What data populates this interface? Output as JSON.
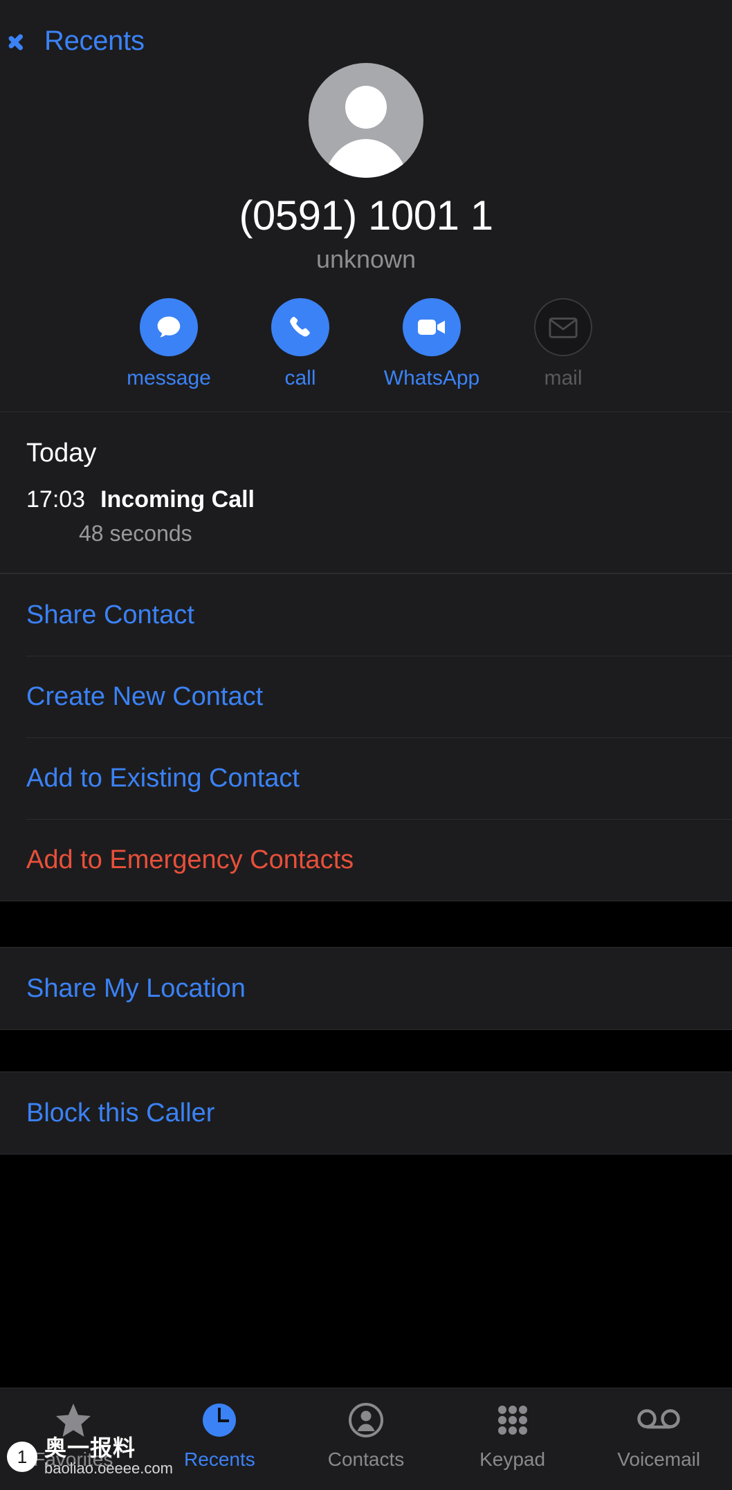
{
  "nav": {
    "back_label": "Recents",
    "back_icon": "chevron-left-icon"
  },
  "contact": {
    "avatar_icon": "person-placeholder-icon",
    "phone_number": "(0591) 1001 1",
    "sub_label": "unknown"
  },
  "actions": [
    {
      "label": "message",
      "icon": "message-bubble-icon",
      "disabled": false
    },
    {
      "label": "call",
      "icon": "phone-icon",
      "disabled": false
    },
    {
      "label": "WhatsApp",
      "icon": "video-camera-icon",
      "disabled": false
    },
    {
      "label": "mail",
      "icon": "envelope-icon",
      "disabled": true
    }
  ],
  "history": {
    "day_label": "Today",
    "entry": {
      "time": "17:03",
      "type": "Incoming Call",
      "duration": "48 seconds"
    }
  },
  "contact_actions": [
    {
      "label": "Share Contact",
      "style": "normal"
    },
    {
      "label": "Create New Contact",
      "style": "normal"
    },
    {
      "label": "Add to Existing Contact",
      "style": "normal"
    },
    {
      "label": "Add to Emergency Contacts",
      "style": "destructive"
    }
  ],
  "location_actions": [
    {
      "label": "Share My Location",
      "style": "normal"
    }
  ],
  "block_actions": [
    {
      "label": "Block this Caller",
      "style": "normal"
    }
  ],
  "tabs": [
    {
      "label": "Favorites",
      "icon": "star-icon",
      "active": false
    },
    {
      "label": "Recents",
      "icon": "clock-icon",
      "active": true
    },
    {
      "label": "Contacts",
      "icon": "person-circle-icon",
      "active": false
    },
    {
      "label": "Keypad",
      "icon": "keypad-grid-icon",
      "active": false
    },
    {
      "label": "Voicemail",
      "icon": "voicemail-icon",
      "active": false
    }
  ],
  "watermark": {
    "badge": "1",
    "title": "奥一报料",
    "url": "baoliao.oeeee.com"
  },
  "colors": {
    "accent_blue": "#3b82f6",
    "destructive_red": "#e8503a",
    "cell_background": "#1c1c1e",
    "page_background": "#000000",
    "secondary_text": "#8e8e93"
  }
}
